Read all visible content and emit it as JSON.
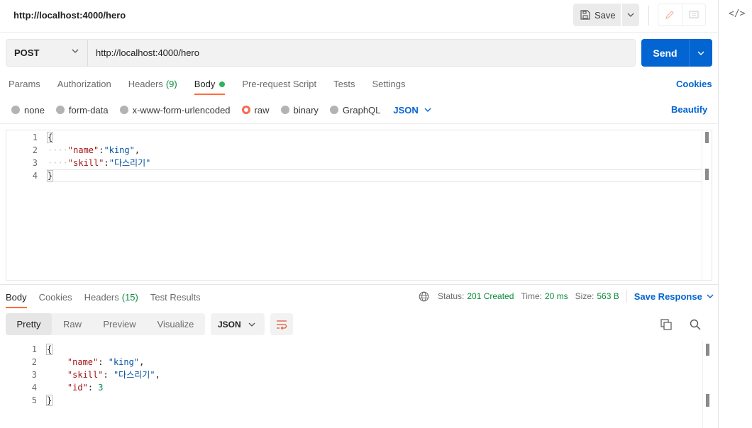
{
  "titlebar": {
    "title": "http://localhost:4000/hero",
    "save_label": "Save"
  },
  "request": {
    "method": "POST",
    "url": "http://localhost:4000/hero",
    "send_label": "Send"
  },
  "request_tabs": [
    {
      "label": "Params"
    },
    {
      "label": "Authorization"
    },
    {
      "label": "Headers",
      "count": "(9)"
    },
    {
      "label": "Body",
      "active": true
    },
    {
      "label": "Pre-request Script"
    },
    {
      "label": "Tests"
    },
    {
      "label": "Settings"
    }
  ],
  "cookies_label": "Cookies",
  "body_types": {
    "options": [
      "none",
      "form-data",
      "x-www-form-urlencoded",
      "raw",
      "binary",
      "GraphQL"
    ],
    "selected": "raw",
    "language": "JSON",
    "beautify_label": "Beautify"
  },
  "request_body": {
    "line_numbers": [
      "1",
      "2",
      "3",
      "4"
    ],
    "open_brace": "{",
    "close_brace": "}",
    "key_name": "\"name\"",
    "val_name": "\"king\"",
    "key_skill": "\"skill\"",
    "val_skill": "\"다스리기\""
  },
  "response_tabs": [
    {
      "label": "Body",
      "active": true
    },
    {
      "label": "Cookies"
    },
    {
      "label": "Headers",
      "count": "(15)"
    },
    {
      "label": "Test Results"
    }
  ],
  "response_status": {
    "status_label": "Status:",
    "status_value": "201 Created",
    "time_label": "Time:",
    "time_value": "20 ms",
    "size_label": "Size:",
    "size_value": "563 B",
    "save_response_label": "Save Response"
  },
  "response_view": {
    "modes": [
      "Pretty",
      "Raw",
      "Preview",
      "Visualize"
    ],
    "active_mode": "Pretty",
    "format": "JSON"
  },
  "response_body": {
    "line_numbers": [
      "1",
      "2",
      "3",
      "4",
      "5"
    ],
    "open_brace": "{",
    "close_brace": "}",
    "key_name": "\"name\"",
    "val_name": "\"king\"",
    "key_skill": "\"skill\"",
    "val_skill": "\"다스리기\"",
    "key_id": "\"id\"",
    "val_id": "3"
  },
  "colors": {
    "accent_blue": "#0265d2",
    "active_tab_underline": "#ff6c37",
    "status_green": "#0b8a3a",
    "radio_selected": "#f76b55"
  }
}
